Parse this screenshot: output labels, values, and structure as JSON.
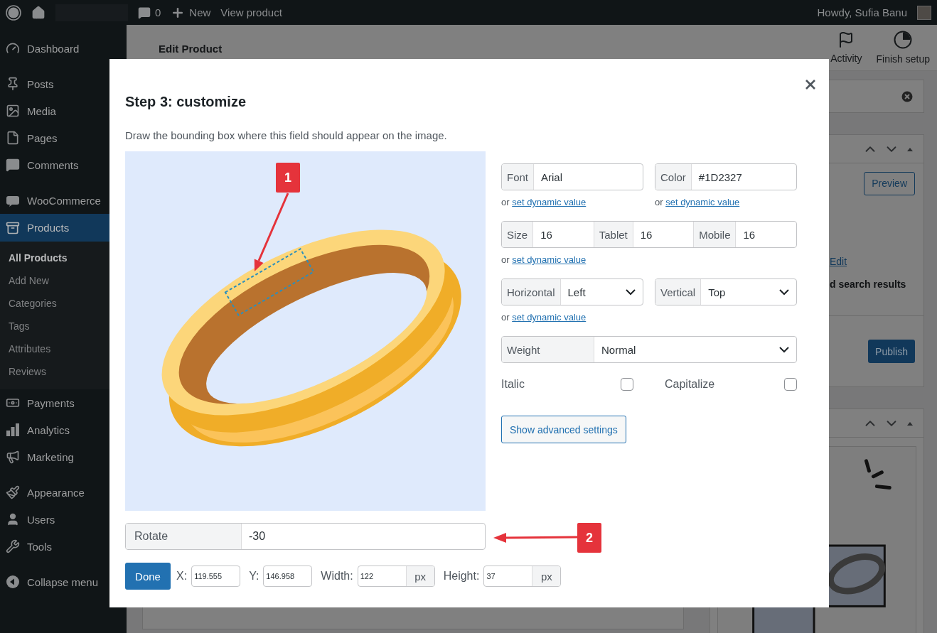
{
  "admin_bar": {
    "comments_count": "0",
    "new_label": "New",
    "view_label": "View product",
    "greeting": "Howdy, Sufia Banu"
  },
  "sidebar": {
    "groups": [
      [
        {
          "label": "Dashboard",
          "kind": "dashboard",
          "selected": false
        }
      ],
      [
        {
          "label": "Posts",
          "kind": "posts",
          "selected": false
        },
        {
          "label": "Media",
          "kind": "media",
          "selected": false
        },
        {
          "label": "Pages",
          "kind": "pages",
          "selected": false
        },
        {
          "label": "Comments",
          "kind": "comments",
          "selected": false
        }
      ],
      [
        {
          "label": "WooCommerce",
          "kind": "woo",
          "selected": false
        },
        {
          "label": "Products",
          "kind": "products",
          "selected": true,
          "children": [
            {
              "label": "All Products",
              "selected": true
            },
            {
              "label": "Add New",
              "selected": false
            },
            {
              "label": "Categories",
              "selected": false
            },
            {
              "label": "Tags",
              "selected": false
            },
            {
              "label": "Attributes",
              "selected": false
            },
            {
              "label": "Reviews",
              "selected": false
            }
          ]
        },
        {
          "label": "Payments",
          "kind": "payments",
          "selected": false
        },
        {
          "label": "Analytics",
          "kind": "analytics",
          "selected": false
        },
        {
          "label": "Marketing",
          "kind": "marketing",
          "selected": false
        }
      ],
      [
        {
          "label": "Appearance",
          "kind": "appearance",
          "selected": false
        },
        {
          "label": "Users",
          "kind": "users",
          "selected": false
        },
        {
          "label": "Tools",
          "kind": "tools",
          "selected": false
        }
      ]
    ],
    "collapse_label": "Collapse menu"
  },
  "header": {
    "title": "Edit Product",
    "actions": [
      {
        "label": "Activity",
        "kind": "flag"
      },
      {
        "label": "Finish setup",
        "kind": "progress"
      }
    ]
  },
  "side_panels": {
    "preview_button": "Preview",
    "edit_link": "Edit",
    "visibility_text": "d search results",
    "publish_button": "Publish"
  },
  "modal": {
    "title": "Step 3: customize",
    "description": "Draw the bounding box where this field should appear on the image.",
    "annotations": [
      {
        "label": "1"
      },
      {
        "label": "2"
      }
    ],
    "rows": [
      {
        "groups": [
          {
            "kind": "input",
            "segments": [
              {
                "label": "Font",
                "value": "Arial"
              }
            ],
            "link": {
              "prefix": "or",
              "text": "set dynamic value"
            }
          },
          {
            "kind": "input",
            "segments": [
              {
                "label": "Color",
                "value": "#1D2327"
              }
            ],
            "link": {
              "prefix": "or",
              "text": "set dynamic value"
            }
          }
        ]
      },
      {
        "groups": [
          {
            "kind": "input",
            "segments": [
              {
                "label": "Size",
                "value": "16"
              },
              {
                "label": "Tablet",
                "value": "16"
              },
              {
                "label": "Mobile",
                "value": "16"
              }
            ],
            "link": {
              "prefix": "or",
              "text": "set dynamic value"
            }
          }
        ]
      },
      {
        "groups": [
          {
            "kind": "select",
            "segments": [
              {
                "label": "Horizontal",
                "value": "Left"
              }
            ],
            "link": {
              "prefix": "or",
              "text": "set dynamic value"
            }
          },
          {
            "kind": "select",
            "segments": [
              {
                "label": "Vertical",
                "value": "Top"
              }
            ]
          }
        ]
      },
      {
        "groups": [
          {
            "kind": "select",
            "segments": [
              {
                "label": "Weight",
                "value": "Normal"
              }
            ]
          }
        ]
      }
    ],
    "toggles": [
      {
        "label": "Italic",
        "checked": false
      },
      {
        "label": "Capitalize",
        "checked": false
      }
    ],
    "advanced_button": "Show advanced settings",
    "rotate": {
      "label": "Rotate",
      "value": "-30"
    },
    "done_button": "Done",
    "coords": [
      {
        "label": "X:",
        "value": "119.555"
      },
      {
        "label": "Y:",
        "value": "146.958"
      },
      {
        "label": "Width:",
        "value": "122",
        "unit": "px"
      },
      {
        "label": "Height:",
        "value": "37",
        "unit": "px"
      }
    ]
  }
}
